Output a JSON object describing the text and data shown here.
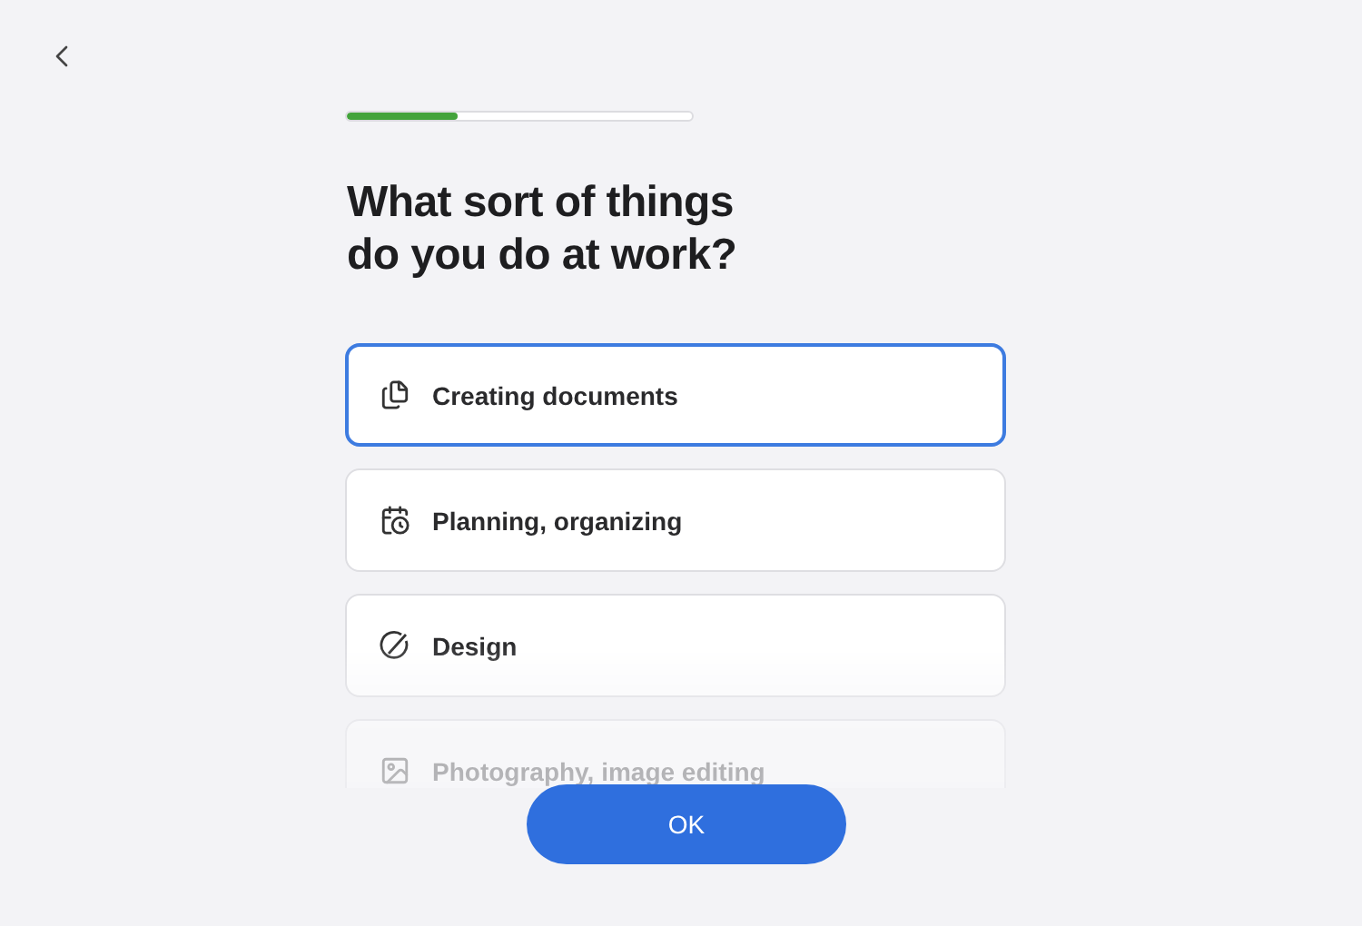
{
  "progress": {
    "level": 0.32
  },
  "title": "What sort of things do you do at work?",
  "options": [
    {
      "label": "Creating documents",
      "selected": true
    },
    {
      "label": "Planning, organizing",
      "selected": false
    },
    {
      "label": "Design",
      "selected": false
    },
    {
      "label": "Photography, image editing",
      "selected": false
    }
  ],
  "button": "OK"
}
